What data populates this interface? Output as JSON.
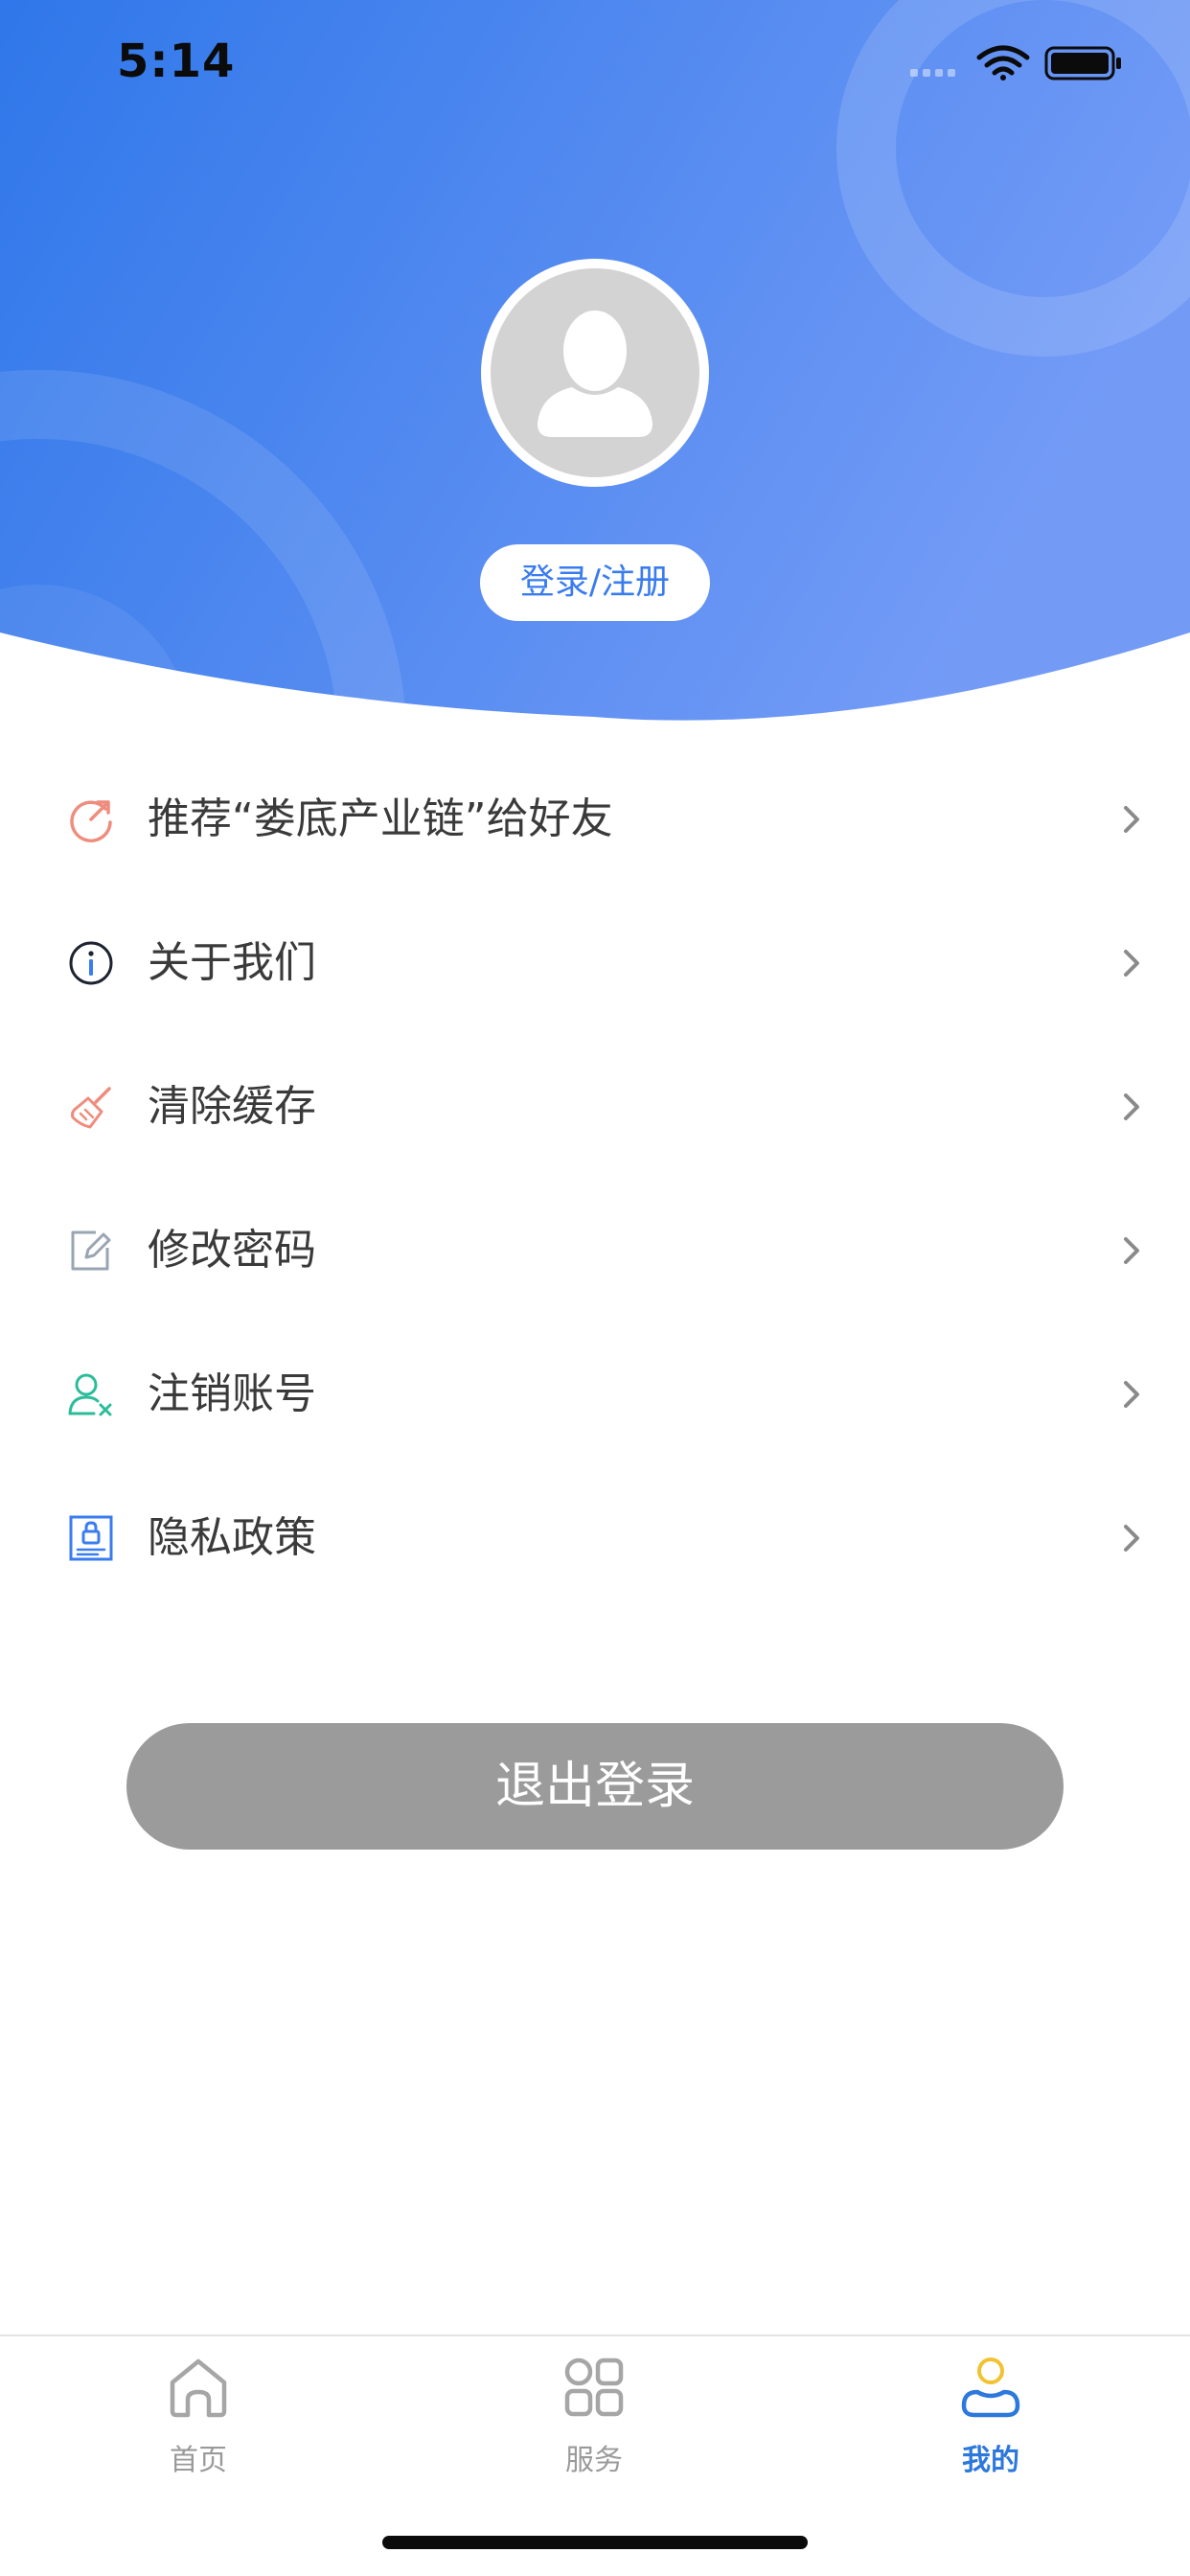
{
  "status_bar": {
    "time": "5:14"
  },
  "profile": {
    "login_label": "登录/注册"
  },
  "menu": [
    {
      "label": "推荐“娄底产业链”给好友",
      "icon": "share-icon",
      "color": "#ef8c7d"
    },
    {
      "label": "关于我们",
      "icon": "info-icon",
      "color": "#1d2330"
    },
    {
      "label": "清除缓存",
      "icon": "broom-icon",
      "color": "#ef8c7d"
    },
    {
      "label": "修改密码",
      "icon": "edit-icon",
      "color": "#9aa5b3"
    },
    {
      "label": "注销账号",
      "icon": "user-remove-icon",
      "color": "#2bbd9a"
    },
    {
      "label": "隐私政策",
      "icon": "privacy-lock-icon",
      "color": "#3a7cf0"
    }
  ],
  "logout_label": "退出登录",
  "tabbar": {
    "tabs": [
      {
        "label": "首页",
        "icon": "home-icon",
        "active": false
      },
      {
        "label": "服务",
        "icon": "grid-icon",
        "active": false
      },
      {
        "label": "我的",
        "icon": "profile-icon",
        "active": true
      }
    ]
  },
  "colors": {
    "header_gradient_start": "#2f77ea",
    "header_gradient_end": "#739bf6",
    "accent": "#2c78dd",
    "logout_bg": "#9b9b9b"
  }
}
